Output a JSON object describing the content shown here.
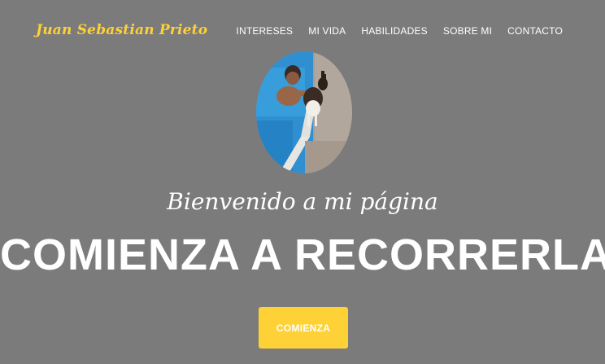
{
  "header": {
    "brand": "Juan Sebastian Prieto",
    "nav": [
      {
        "label": "INTERESES"
      },
      {
        "label": "MI VIDA"
      },
      {
        "label": "HABILIDADES"
      },
      {
        "label": "SOBRE MI"
      },
      {
        "label": "CONTACTO"
      }
    ]
  },
  "hero": {
    "subheading": "Bienvenido a mi página",
    "heading": "COMIENZA A RECORRERLA",
    "cta_label": "COMIENZA"
  },
  "colors": {
    "background": "#7b7b7b",
    "accent": "#fed136",
    "text": "#ffffff"
  }
}
